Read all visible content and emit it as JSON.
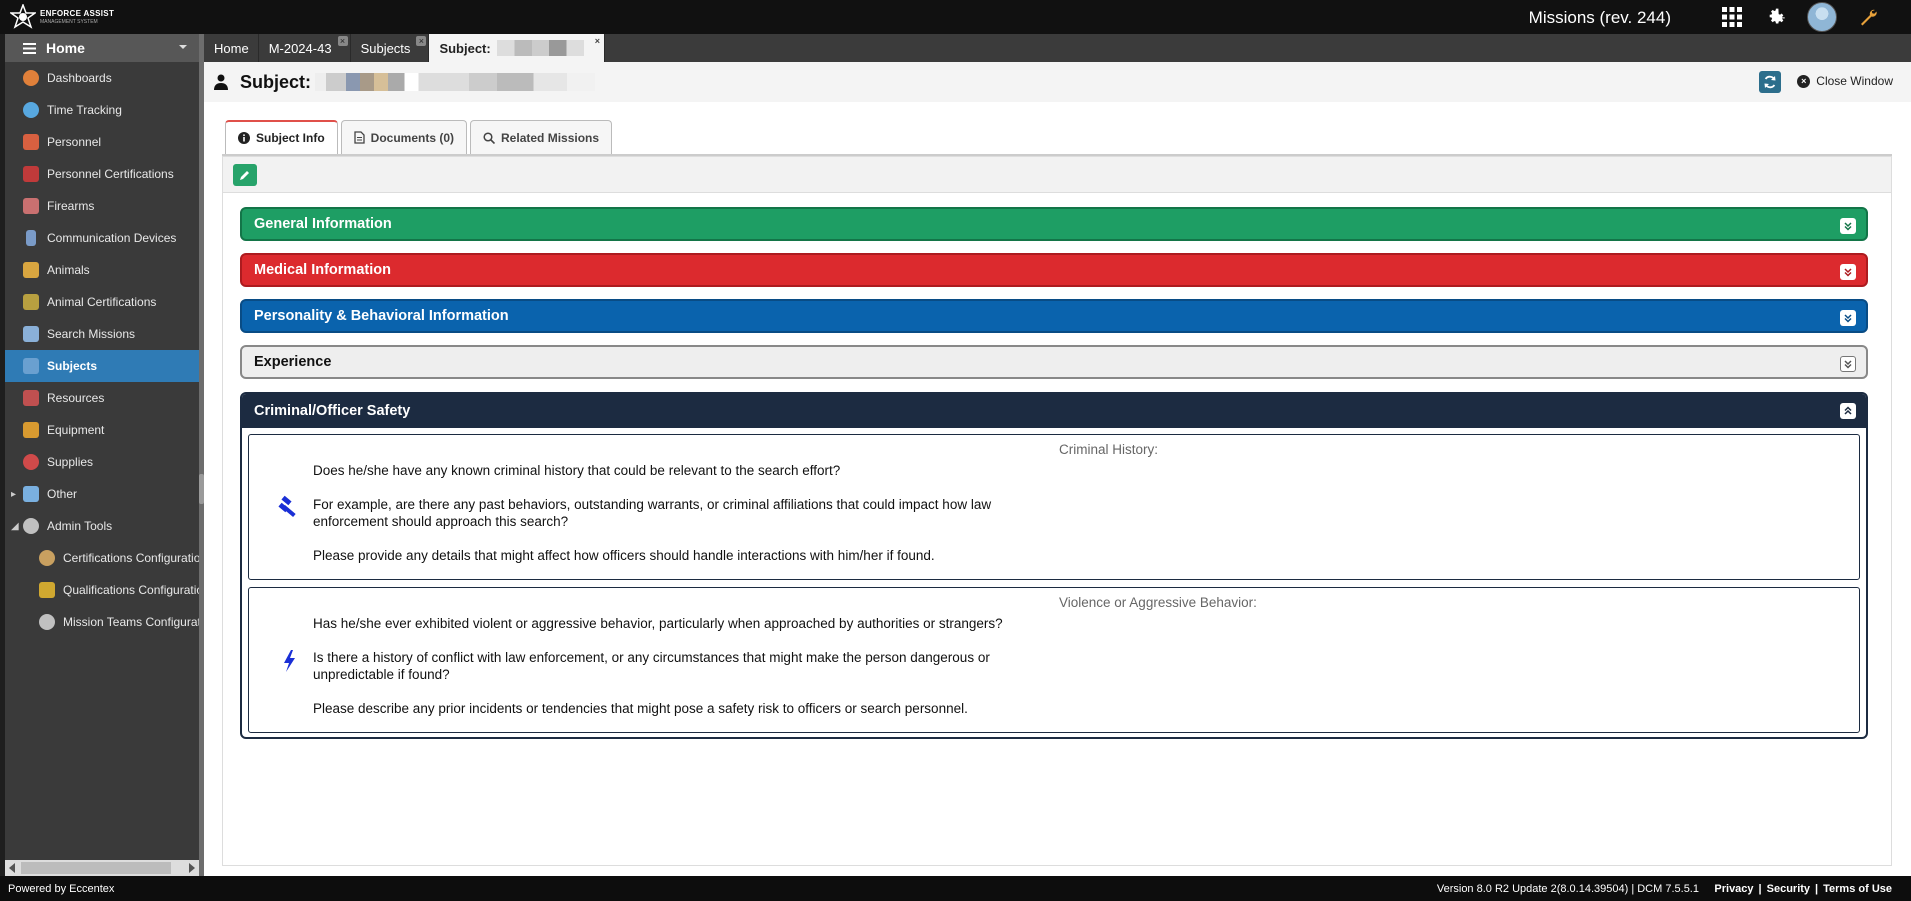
{
  "app": {
    "logo_line1": "ENFORCE ASSIST",
    "logo_line2": "MANAGEMENT SYSTEM",
    "title": "Missions (rev. 244)"
  },
  "top_icons": [
    "apps-grid-icon",
    "settings-gear-icon",
    "user-avatar",
    "tools-wrench-icon"
  ],
  "sidebar": {
    "home_label": "Home",
    "items": [
      {
        "label": "Dashboards",
        "icon": "dashboard-icon",
        "color": "#e0803a"
      },
      {
        "label": "Time Tracking",
        "icon": "clock-icon",
        "color": "#58a8e0"
      },
      {
        "label": "Personnel",
        "icon": "person-icon",
        "color": "#d86040"
      },
      {
        "label": "Personnel Certifications",
        "icon": "certificate-icon",
        "color": "#c03a3a"
      },
      {
        "label": "Firearms",
        "icon": "firearm-icon",
        "color": "#c97070"
      },
      {
        "label": "Communication Devices",
        "icon": "radio-icon",
        "color": "#7a9bc8"
      },
      {
        "label": "Animals",
        "icon": "animal-icon",
        "color": "#d9a640"
      },
      {
        "label": "Animal Certifications",
        "icon": "animal-cert-icon",
        "color": "#b8a040"
      },
      {
        "label": "Search Missions",
        "icon": "search-mission-icon",
        "color": "#8ab0d8"
      },
      {
        "label": "Subjects",
        "icon": "subject-icon",
        "color": "#6aa0d0"
      },
      {
        "label": "Resources",
        "icon": "resources-icon",
        "color": "#c05050"
      },
      {
        "label": "Equipment",
        "icon": "equipment-icon",
        "color": "#d89a30"
      },
      {
        "label": "Supplies",
        "icon": "supplies-icon",
        "color": "#d04a4a"
      },
      {
        "label": "Other",
        "icon": "wrench-icon",
        "color": "#7ab0e0"
      },
      {
        "label": "Admin Tools",
        "icon": "gear-icon",
        "color": "#c0c0c0"
      },
      {
        "label": "Certifications Configuratio",
        "icon": "gear-icon",
        "color": "#c8a060"
      },
      {
        "label": "Qualifications Configuratio",
        "icon": "star-icon",
        "color": "#d0a830"
      },
      {
        "label": "Mission Teams Configurat",
        "icon": "gear-icon",
        "color": "#c0c0c0"
      }
    ]
  },
  "tabs": [
    {
      "label": "Home"
    },
    {
      "label": "M-2024-43"
    },
    {
      "label": "Subjects"
    },
    {
      "label": "Subject:"
    }
  ],
  "subject": {
    "title_prefix": "Subject:",
    "refresh_icon": "refresh-icon",
    "close_label": "Close Window"
  },
  "subtabs": [
    {
      "label": "Subject Info",
      "icon": "info-icon"
    },
    {
      "label": "Documents (0)",
      "icon": "document-icon"
    },
    {
      "label": "Related Missions",
      "icon": "search-icon"
    }
  ],
  "sections": [
    {
      "label": "General Information",
      "color": "#1e9e64"
    },
    {
      "label": "Medical Information",
      "color": "#dc2a2e"
    },
    {
      "label": "Personality & Behavioral Information",
      "color": "#0a63ad"
    },
    {
      "label": "Experience",
      "color": "#eeeeee"
    }
  ],
  "criminal": {
    "header": "Criminal/Officer Safety",
    "questions": [
      {
        "label": "Criminal History:",
        "icon": "gavel-icon",
        "lines": [
          "Does he/she have any known criminal history that could be relevant to the search effort?",
          "For example, are there any past behaviors, outstanding warrants, or criminal affiliations that could impact how law enforcement should approach this search?",
          "Please provide any details that might affect how officers should handle interactions with him/her if found."
        ]
      },
      {
        "label": "Violence or Aggressive Behavior:",
        "icon": "lightning-icon",
        "lines": [
          "Has he/she ever exhibited violent or aggressive behavior, particularly when approached by authorities or strangers?",
          "Is there a history of conflict with law enforcement, or any circumstances that might make the person dangerous or unpredictable if found?",
          "Please describe any prior incidents or tendencies that might pose a safety risk to officers or search personnel."
        ]
      }
    ]
  },
  "footer": {
    "powered": "Powered by Eccentex",
    "version": "Version   8.0 R2 Update 2(8.0.14.39504) | DCM 7.5.5.1",
    "links": [
      "Privacy",
      "Security",
      "Terms of Use"
    ]
  }
}
